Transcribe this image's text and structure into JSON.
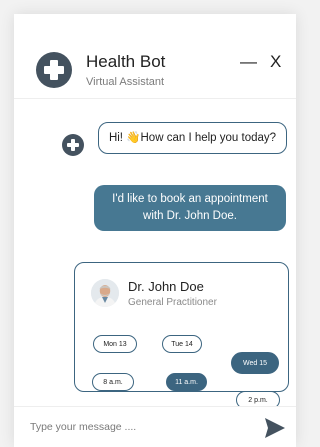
{
  "header": {
    "title": "Health Bot",
    "subtitle": "Virtual Assistant",
    "minimize_label": "—",
    "close_label": "X"
  },
  "messages": [
    {
      "from": "bot",
      "text": "Hi! 👋How can I help you today?"
    },
    {
      "from": "user",
      "text": "I'd like to book an appointment with Dr. John Doe."
    }
  ],
  "doctor_card": {
    "name": "Dr. John Doe",
    "role": "General Practitioner",
    "days": [
      "Mon 13",
      "Tue 14",
      "Wed 15"
    ],
    "times": [
      "8 a.m.",
      "11 a.m.",
      "2 p.m."
    ],
    "selected_day": "Wed 15",
    "selected_time": "11 a.m."
  },
  "composer": {
    "placeholder": "Type your message ...."
  },
  "colors": {
    "accent": "#3c6580",
    "user_bubble": "#477892",
    "logo": "#44525f"
  },
  "icons": {
    "bot_logo": "medical-cross-icon",
    "send": "send-icon"
  }
}
